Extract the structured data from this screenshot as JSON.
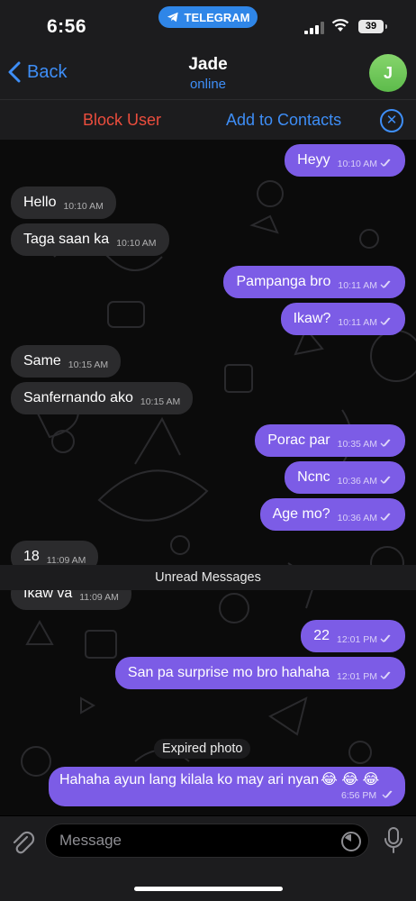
{
  "status_bar": {
    "time": "6:56",
    "app_pill": "TELEGRAM",
    "battery": "39"
  },
  "header": {
    "back_label": "Back",
    "contact_name": "Jade",
    "status": "online",
    "avatar_initial": "J"
  },
  "actions": {
    "block_label": "Block User",
    "add_label": "Add to Contacts"
  },
  "messages": [
    {
      "dir": "out",
      "text": "Heyy",
      "time": "10:10 AM"
    },
    {
      "dir": "in",
      "text": "Hello",
      "time": "10:10 AM"
    },
    {
      "dir": "in",
      "text": "Taga saan ka",
      "time": "10:10 AM"
    },
    {
      "dir": "out",
      "text": "Pampanga bro",
      "time": "10:11 AM"
    },
    {
      "dir": "out",
      "text": "Ikaw?",
      "time": "10:11 AM"
    },
    {
      "dir": "in",
      "text": "Same",
      "time": "10:15 AM"
    },
    {
      "dir": "in",
      "text": "Sanfernando ako",
      "time": "10:15 AM"
    },
    {
      "dir": "out",
      "text": "Porac par",
      "time": "10:35 AM"
    },
    {
      "dir": "out",
      "text": "Ncnc",
      "time": "10:36 AM"
    },
    {
      "dir": "out",
      "text": "Age mo?",
      "time": "10:36 AM"
    },
    {
      "dir": "in",
      "text": "18",
      "time": "11:09 AM"
    },
    {
      "dir": "in",
      "text": "Ikaw va",
      "time": "11:09 AM"
    },
    {
      "dir": "out",
      "text": "22",
      "time": "12:01 PM"
    },
    {
      "dir": "out",
      "text": "San pa surprise mo bro hahaha",
      "time": "12:01 PM"
    }
  ],
  "unread_label": "Unread Messages",
  "expired_label": "Expired photo",
  "last_message": {
    "text": "Hahaha ayun lang kilala ko may ari nyan",
    "emoji": "😂 😂 😂",
    "time": "6:56 PM"
  },
  "composer": {
    "placeholder": "Message"
  },
  "colors": {
    "outgoing_bubble": "#7c5ce6",
    "incoming_bubble": "#2b2b2d",
    "accent_blue": "#3e8ef7",
    "block_red": "#eb4d3d"
  }
}
